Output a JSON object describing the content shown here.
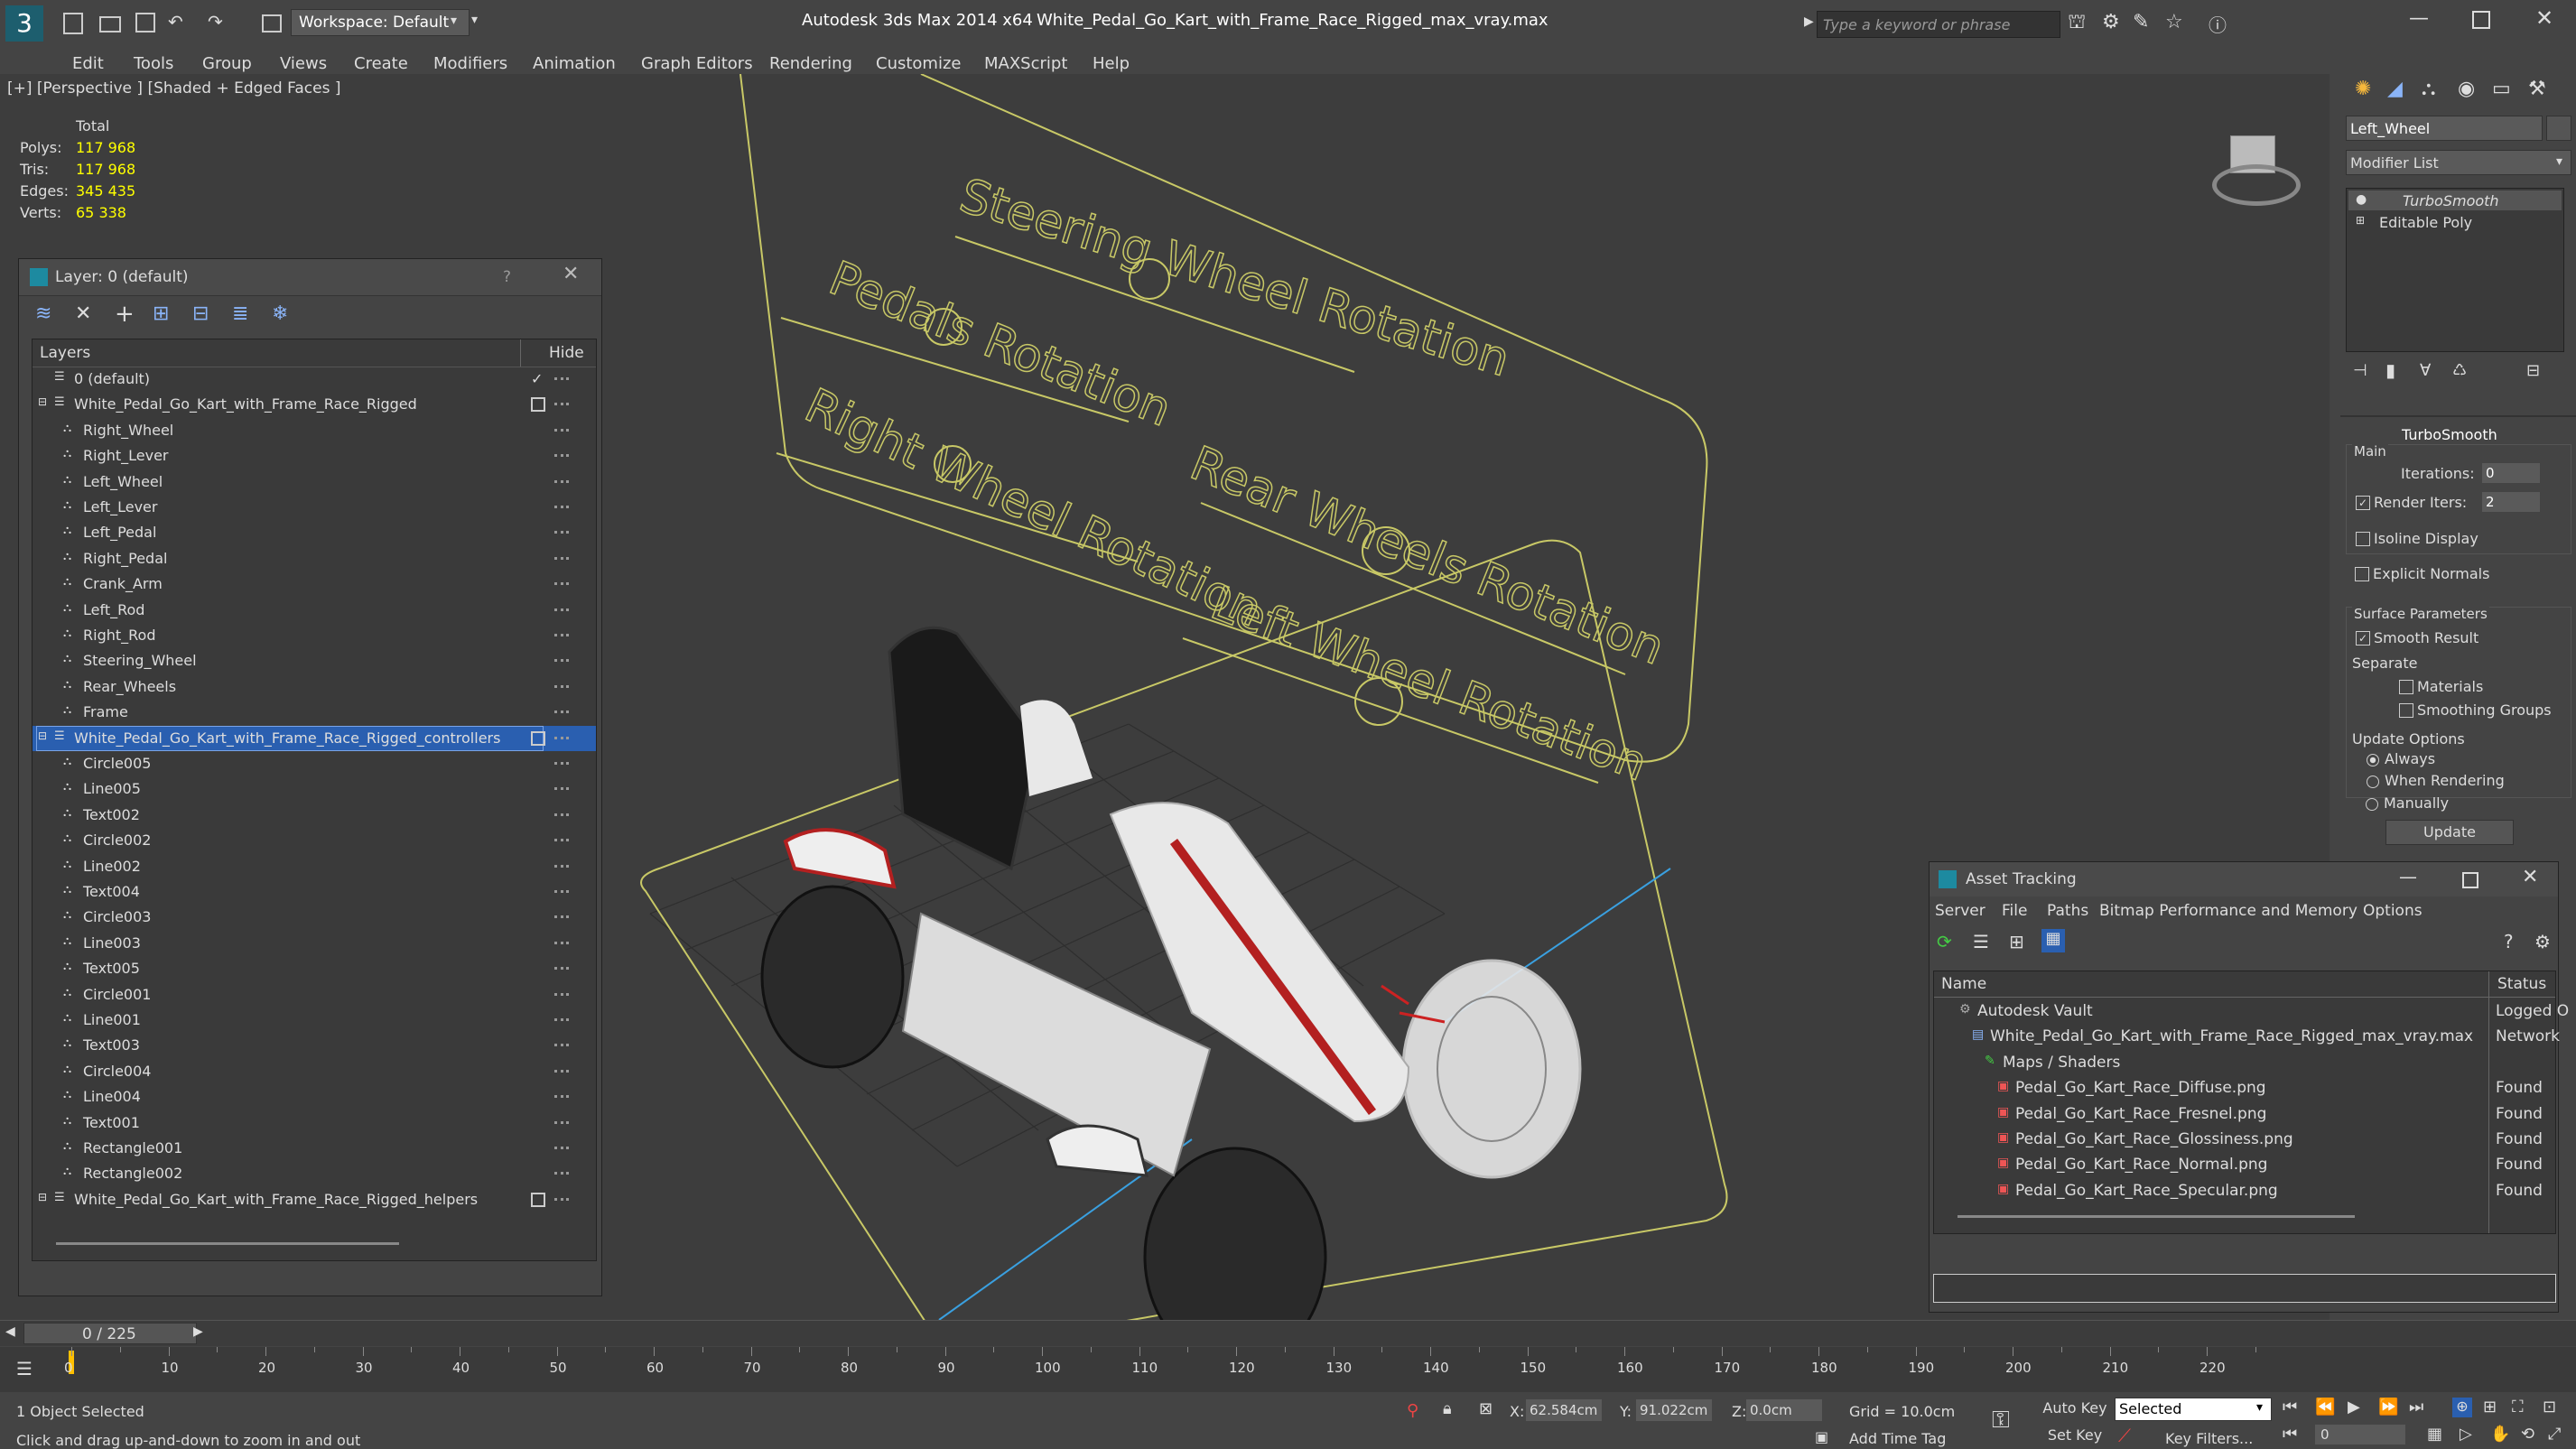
{
  "app": {
    "title": "Autodesk 3ds Max  2014 x64",
    "file": "White_Pedal_Go_Kart_with_Frame_Race_Rigged_max_vray.max",
    "workspace": "Workspace: Default",
    "search_placeholder": "Type a keyword or phrase"
  },
  "menu": [
    "Edit",
    "Tools",
    "Group",
    "Views",
    "Create",
    "Modifiers",
    "Animation",
    "Graph Editors",
    "Rendering",
    "Customize",
    "MAXScript",
    "Help"
  ],
  "viewport": {
    "label": "[+] [Perspective ] [Shaded + Edged Faces ]",
    "stats": {
      "header": "Total",
      "polys_label": "Polys:",
      "polys": "117 968",
      "tris_label": "Tris:",
      "tris": "117 968",
      "edges_label": "Edges:",
      "edges": "345 435",
      "verts_label": "Verts:",
      "verts": "65 338"
    },
    "controls": [
      "Steering Wheel Rotation",
      "Pedals Rotation",
      "Right Wheel Rotation",
      "Rear Wheels Rotation",
      "Left Wheel Rotation"
    ]
  },
  "layer_panel": {
    "title": "Layer: 0 (default)",
    "help": "?",
    "col_layers": "Layers",
    "col_hide": "Hide",
    "rows": [
      {
        "name": "0 (default)",
        "level": 0,
        "type": "layer"
      },
      {
        "name": "White_Pedal_Go_Kart_with_Frame_Race_Rigged",
        "level": 0,
        "type": "layer"
      },
      {
        "name": "Right_Wheel",
        "level": 1,
        "type": "obj"
      },
      {
        "name": "Right_Lever",
        "level": 1,
        "type": "obj"
      },
      {
        "name": "Left_Wheel",
        "level": 1,
        "type": "obj"
      },
      {
        "name": "Left_Lever",
        "level": 1,
        "type": "obj"
      },
      {
        "name": "Left_Pedal",
        "level": 1,
        "type": "obj"
      },
      {
        "name": "Right_Pedal",
        "level": 1,
        "type": "obj"
      },
      {
        "name": "Crank_Arm",
        "level": 1,
        "type": "obj"
      },
      {
        "name": "Left_Rod",
        "level": 1,
        "type": "obj"
      },
      {
        "name": "Right_Rod",
        "level": 1,
        "type": "obj"
      },
      {
        "name": "Steering_Wheel",
        "level": 1,
        "type": "obj"
      },
      {
        "name": "Rear_Wheels",
        "level": 1,
        "type": "obj"
      },
      {
        "name": "Frame",
        "level": 1,
        "type": "obj"
      },
      {
        "name": "White_Pedal_Go_Kart_with_Frame_Race_Rigged_controllers",
        "level": 0,
        "type": "layer",
        "selected": true
      },
      {
        "name": "Circle005",
        "level": 1,
        "type": "obj"
      },
      {
        "name": "Line005",
        "level": 1,
        "type": "obj"
      },
      {
        "name": "Text002",
        "level": 1,
        "type": "obj"
      },
      {
        "name": "Circle002",
        "level": 1,
        "type": "obj"
      },
      {
        "name": "Line002",
        "level": 1,
        "type": "obj"
      },
      {
        "name": "Text004",
        "level": 1,
        "type": "obj"
      },
      {
        "name": "Circle003",
        "level": 1,
        "type": "obj"
      },
      {
        "name": "Line003",
        "level": 1,
        "type": "obj"
      },
      {
        "name": "Text005",
        "level": 1,
        "type": "obj"
      },
      {
        "name": "Circle001",
        "level": 1,
        "type": "obj"
      },
      {
        "name": "Line001",
        "level": 1,
        "type": "obj"
      },
      {
        "name": "Text003",
        "level": 1,
        "type": "obj"
      },
      {
        "name": "Circle004",
        "level": 1,
        "type": "obj"
      },
      {
        "name": "Line004",
        "level": 1,
        "type": "obj"
      },
      {
        "name": "Text001",
        "level": 1,
        "type": "obj"
      },
      {
        "name": "Rectangle001",
        "level": 1,
        "type": "obj"
      },
      {
        "name": "Rectangle002",
        "level": 1,
        "type": "obj"
      },
      {
        "name": "White_Pedal_Go_Kart_with_Frame_Race_Rigged_helpers",
        "level": 0,
        "type": "layer"
      }
    ]
  },
  "command_panel": {
    "object_name": "Left_Wheel",
    "modifier_list": "Modifier List",
    "stack": [
      "TurboSmooth",
      "Editable Poly"
    ],
    "rollout": "TurboSmooth",
    "main": "Main",
    "iterations_label": "Iterations:",
    "iterations": "0",
    "render_iters_label": "Render Iters:",
    "render_iters": "2",
    "isoline": "Isoline Display",
    "explicit_normals": "Explicit Normals",
    "surface_params": "Surface Parameters",
    "smooth_result": "Smooth Result",
    "separate": "Separate",
    "materials": "Materials",
    "smoothing_groups": "Smoothing Groups",
    "update_options": "Update Options",
    "always": "Always",
    "when_rendering": "When Rendering",
    "manually": "Manually",
    "update_btn": "Update"
  },
  "asset_tracking": {
    "title": "Asset Tracking",
    "menu": [
      "Server",
      "File",
      "Paths",
      "Bitmap Performance and Memory",
      "Options"
    ],
    "col_name": "Name",
    "col_status": "Status",
    "rows": [
      {
        "name": "Autodesk Vault",
        "status": "Logged O",
        "indent": 1
      },
      {
        "name": "White_Pedal_Go_Kart_with_Frame_Race_Rigged_max_vray.max",
        "status": "Network",
        "indent": 2
      },
      {
        "name": "Maps / Shaders",
        "status": "",
        "indent": 3
      },
      {
        "name": "Pedal_Go_Kart_Race_Diffuse.png",
        "status": "Found",
        "indent": 4
      },
      {
        "name": "Pedal_Go_Kart_Race_Fresnel.png",
        "status": "Found",
        "indent": 4
      },
      {
        "name": "Pedal_Go_Kart_Race_Glossiness.png",
        "status": "Found",
        "indent": 4
      },
      {
        "name": "Pedal_Go_Kart_Race_Normal.png",
        "status": "Found",
        "indent": 4
      },
      {
        "name": "Pedal_Go_Kart_Race_Specular.png",
        "status": "Found",
        "indent": 4
      }
    ]
  },
  "timeline": {
    "frame": "0 / 225",
    "ticks": [
      "0",
      "10",
      "20",
      "30",
      "40",
      "50",
      "60",
      "70",
      "80",
      "90",
      "100",
      "110",
      "120",
      "130",
      "140",
      "150",
      "160",
      "170",
      "180",
      "190",
      "200",
      "210",
      "220"
    ]
  },
  "status": {
    "selected": "1 Object Selected",
    "prompt": "Click and drag up-and-down to zoom in and out",
    "x_label": "X:",
    "x": "62.584cm",
    "y_label": "Y:",
    "y": "91.022cm",
    "z_label": "Z:",
    "z": "0.0cm",
    "grid": "Grid = 10.0cm",
    "add_time_tag": "Add Time Tag",
    "auto_key": "Auto Key",
    "set_key": "Set Key",
    "selected_set": "Selected",
    "key_filters": "Key Filters...",
    "frame_field": "0"
  },
  "colors": {
    "accent": "#2a5fb0",
    "stats": "#ffff00",
    "control": "#c8c866"
  }
}
